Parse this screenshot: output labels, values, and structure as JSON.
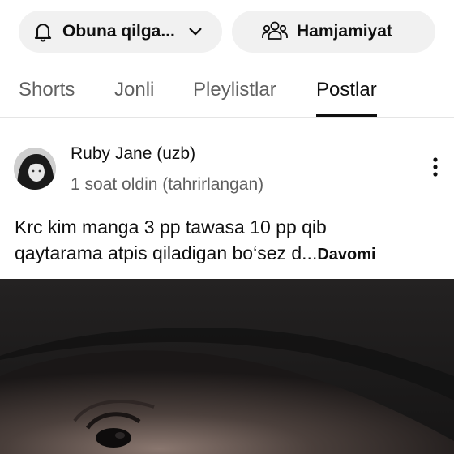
{
  "chips": {
    "subscribe_label": "Obuna qilga...",
    "community_label": "Hamjamiyat"
  },
  "tabs": [
    {
      "label": "Shorts",
      "active": false
    },
    {
      "label": "Jonli",
      "active": false
    },
    {
      "label": "Pleylistlar",
      "active": false
    },
    {
      "label": "Postlar",
      "active": true
    }
  ],
  "post": {
    "author": "Ruby Jane (uzb)",
    "time": "1 soat oldin (tahrirlangan)",
    "text_line1": "Krc kim manga 3 pp tawasa 10 pp qib",
    "text_line2": "qaytarama atpis qiladigan bo‘sez d...",
    "read_more": "Davomi"
  },
  "icons": {
    "bell": "bell-icon",
    "chevron": "chevron-down-icon",
    "community": "people-icon",
    "more": "more-vert-icon"
  },
  "colors": {
    "chip_bg": "#f1f1f1",
    "text_primary": "#0f0f0f",
    "text_secondary": "#606060",
    "divider": "#e5e5e5"
  }
}
